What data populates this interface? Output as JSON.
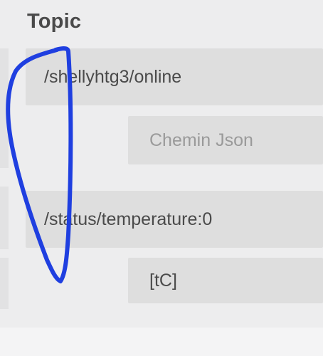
{
  "header": {
    "title": "Topic"
  },
  "rows": [
    {
      "topic_value": "/shellyhtg3/online",
      "json_path_placeholder": "Chemin Json",
      "json_path_value": ""
    },
    {
      "topic_value": "/status/temperature:0",
      "json_path_placeholder": "",
      "json_path_value": "[tC]"
    }
  ],
  "annotation": {
    "color": "#1f3fe0"
  },
  "colors": {
    "background": "#ededee",
    "field": "#dedede",
    "text": "#4a4a4a",
    "placeholder": "#9a9a9a"
  }
}
